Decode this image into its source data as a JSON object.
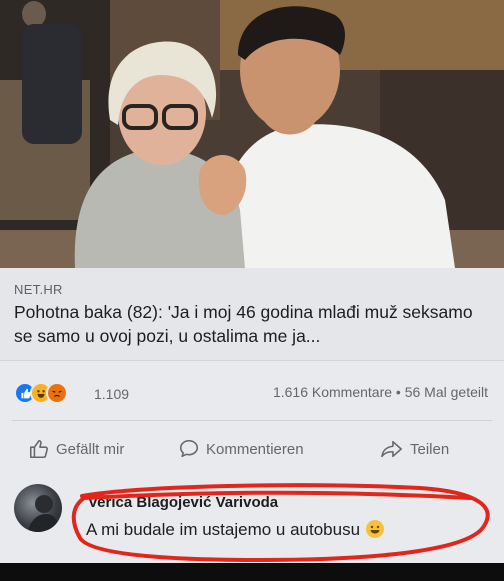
{
  "post": {
    "image_alt": "photo",
    "link": {
      "source": "NET.HR",
      "headline": "Pohotna baka (82): 'Ja i moj 46 godina mlađi muž seksamo se samo u ovoj pozi, u ostalima me ja..."
    },
    "reactions": {
      "icons": [
        "like-icon",
        "haha-icon",
        "angry-icon"
      ],
      "count": "1.109"
    },
    "engagement": {
      "comments": "1.616 Kommentare",
      "separator": "•",
      "shares": "56 Mal geteilt"
    },
    "actions": {
      "like": "Gefällt mir",
      "comment": "Kommentieren",
      "share": "Teilen"
    }
  },
  "comment": {
    "author": "Verica Blagojević Varivoda",
    "text": "A mi budale im ustajemo u autobusu",
    "emoji": "grinning-face-icon"
  },
  "colors": {
    "accent": "#1877f2",
    "annotation": "#e3261b",
    "card_bg": "#e9eaed",
    "text_secondary": "#65676b"
  }
}
